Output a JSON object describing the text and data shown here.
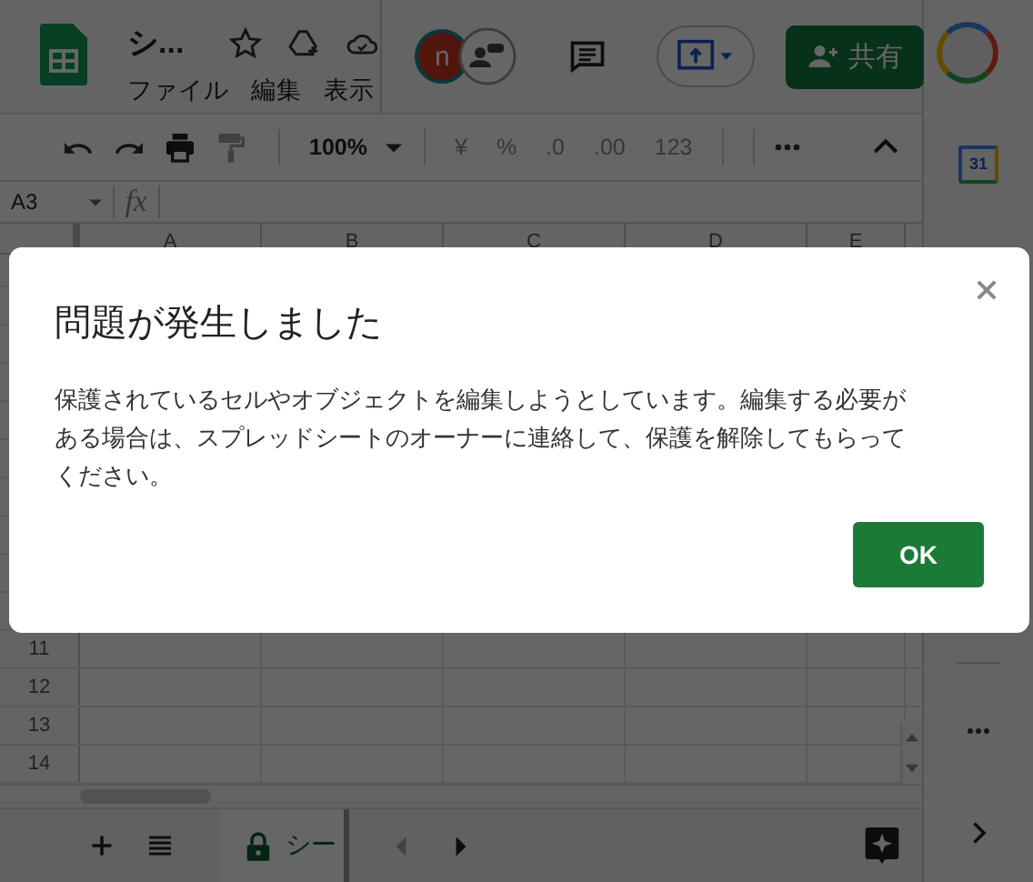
{
  "header": {
    "title": "シ...",
    "menu": [
      "ファイル",
      "編集",
      "表示"
    ],
    "avatar_initial": "n",
    "share_button": "共有"
  },
  "toolbar": {
    "zoom": "100%",
    "format_items": [
      "¥",
      "%",
      ".0",
      ".00",
      "123"
    ]
  },
  "formula_bar": {
    "cell_ref": "A3",
    "fx_label": "fx"
  },
  "grid": {
    "columns": [
      "A",
      "B",
      "C",
      "D",
      "E"
    ],
    "rows": [
      "11",
      "12",
      "13",
      "14"
    ]
  },
  "sheet_bar": {
    "tabs": [
      {
        "label": "シー",
        "locked": true,
        "selected": true
      }
    ]
  },
  "side_panel": {
    "calendar_label": "31"
  },
  "dialog": {
    "title": "問題が発生しました",
    "message": "保護されているセルやオブジェクトを編集しようとしています。編集する必要がある場合は、スプレッドシートのオーナーに連絡して、保護を解除してもらってください。",
    "ok_button": "OK"
  }
}
